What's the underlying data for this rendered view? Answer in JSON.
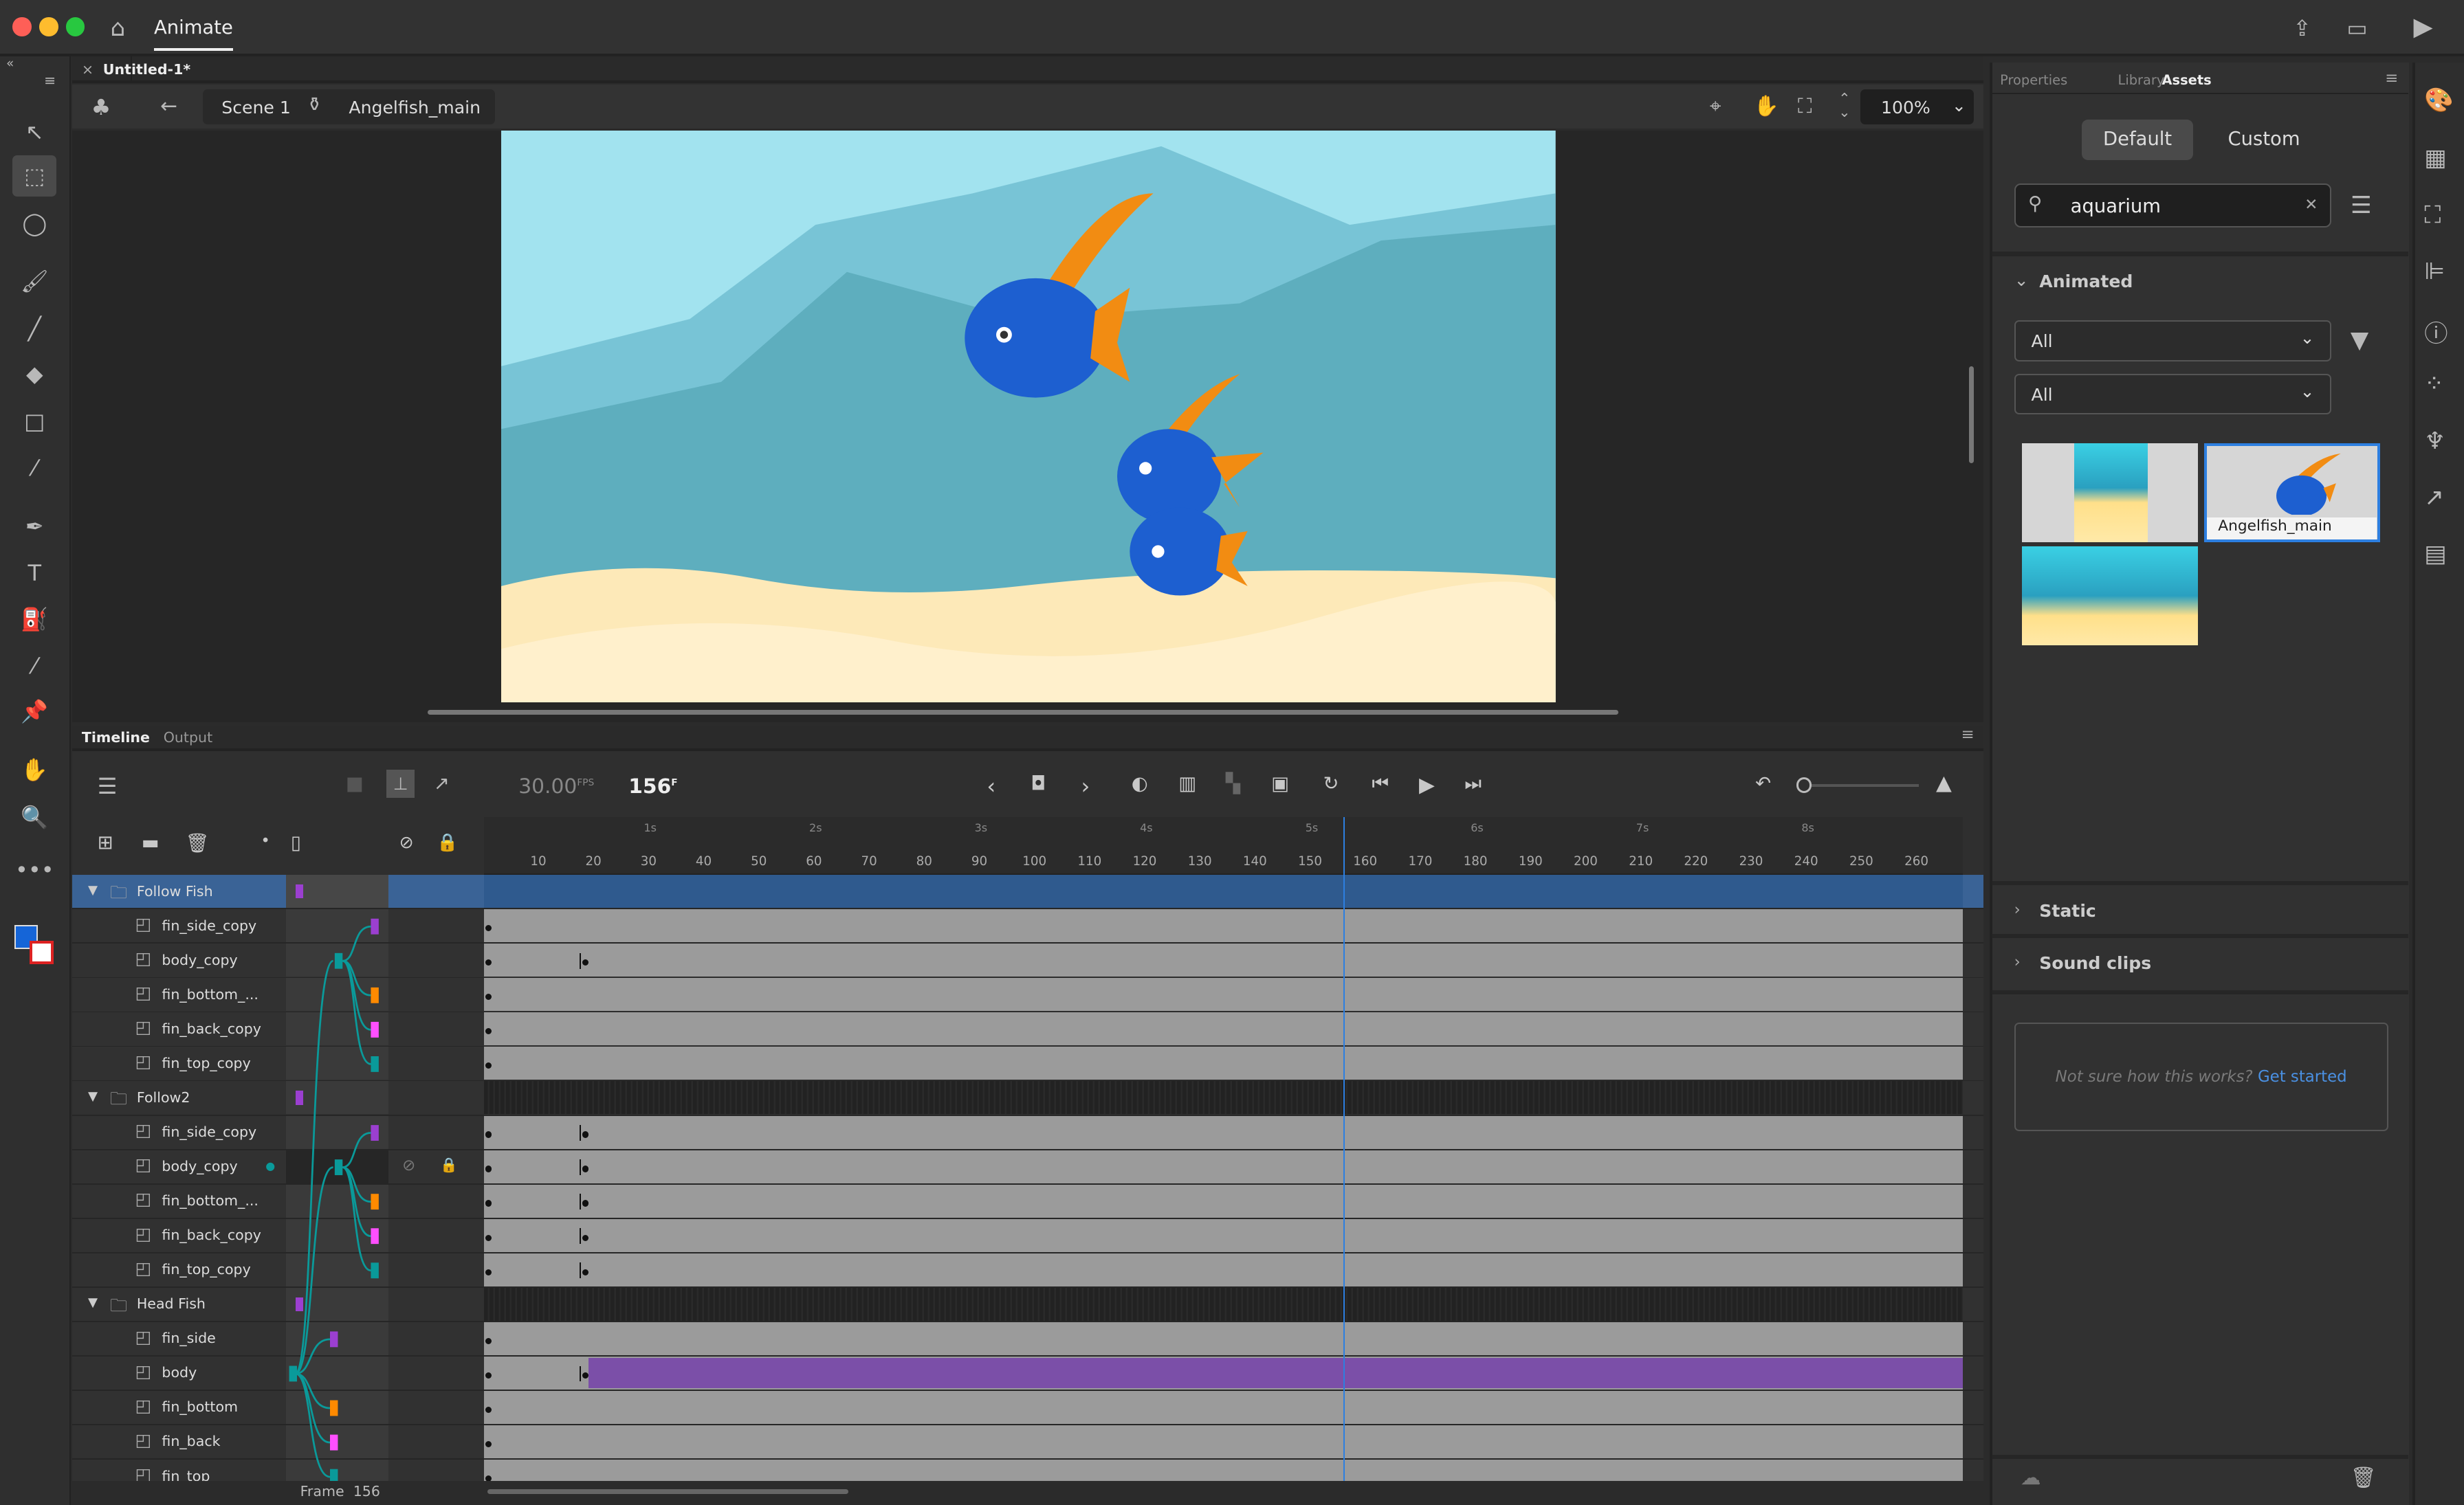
{
  "app": {
    "title": "Animate",
    "document_tab": "Untitled-1*"
  },
  "editbar": {
    "scene": "Scene 1",
    "symbol": "Angelfish_main",
    "zoom": "100%"
  },
  "timeline": {
    "tabs": [
      "Timeline",
      "Output"
    ],
    "fps": "30.00",
    "fps_unit": "FPS",
    "frame": "156",
    "frame_unit": "F",
    "current_frame": 156,
    "seconds_labels": [
      "1s",
      "2s",
      "3s",
      "4s",
      "5s",
      "6s",
      "7s",
      "8s"
    ],
    "frame_labels": [
      "10",
      "20",
      "30",
      "40",
      "50",
      "60",
      "70",
      "80",
      "90",
      "100",
      "110",
      "120",
      "130",
      "140",
      "150",
      "160",
      "170",
      "180",
      "190",
      "200",
      "210",
      "220",
      "230",
      "240",
      "250",
      "260"
    ],
    "status": "Frame  156",
    "layers": [
      {
        "name": "Follow Fish",
        "type": "folder",
        "marker": "#9b3fd0",
        "selected": true,
        "track": "selected"
      },
      {
        "name": "fin_side_copy",
        "type": "layer",
        "marker": "#9b3fd0",
        "track": "gray"
      },
      {
        "name": "body_copy",
        "type": "layer",
        "marker": "#0a9a9a",
        "track": "gray",
        "key": 18
      },
      {
        "name": "fin_bottom_...",
        "type": "layer",
        "marker": "#ff8a00",
        "track": "gray"
      },
      {
        "name": "fin_back_copy",
        "type": "layer",
        "marker": "#ff4fff",
        "track": "gray"
      },
      {
        "name": "fin_top_copy",
        "type": "layer",
        "marker": "#0a9a9a",
        "track": "gray"
      },
      {
        "name": "Follow2",
        "type": "folder",
        "marker": "#9b3fd0",
        "track": "dark"
      },
      {
        "name": "fin_side_copy",
        "type": "layer",
        "marker": "#9b3fd0",
        "track": "gray",
        "key": 18
      },
      {
        "name": "body_copy",
        "type": "layer",
        "marker": "#0a9a9a",
        "track": "gray",
        "key": 18,
        "hover": true
      },
      {
        "name": "fin_bottom_...",
        "type": "layer",
        "marker": "#ff8a00",
        "track": "gray",
        "key": 18
      },
      {
        "name": "fin_back_copy",
        "type": "layer",
        "marker": "#ff4fff",
        "track": "gray",
        "key": 18
      },
      {
        "name": "fin_top_copy",
        "type": "layer",
        "marker": "#0a9a9a",
        "track": "gray",
        "key": 18
      },
      {
        "name": "Head Fish",
        "type": "folder",
        "marker": "#9b3fd0",
        "track": "dark"
      },
      {
        "name": "fin_side",
        "type": "layer",
        "marker": "#9b3fd0",
        "track": "gray"
      },
      {
        "name": "body",
        "type": "layer",
        "marker": "#0a9a9a",
        "track": "tween",
        "key": 18
      },
      {
        "name": "fin_bottom",
        "type": "layer",
        "marker": "#ff8a00",
        "track": "gray"
      },
      {
        "name": "fin_back",
        "type": "layer",
        "marker": "#ff4fff",
        "track": "gray"
      },
      {
        "name": "fin_top",
        "type": "layer",
        "marker": "#0a9a9a",
        "track": "gray"
      }
    ]
  },
  "assets": {
    "tabs": [
      "Properties",
      "Library",
      "Assets"
    ],
    "active_tab": "Assets",
    "modes": [
      "Default",
      "Custom"
    ],
    "search_value": "aquarium",
    "section_animated": "Animated",
    "filter1": "All",
    "filter2": "All",
    "thumb_label": "Angelfish_main",
    "section_static": "Static",
    "section_sound": "Sound clips",
    "help_text": "Not sure how this works?",
    "help_link": "Get started"
  },
  "colors": {
    "accent": "#2d7fe0",
    "selected_row": "#3a6396",
    "tween": "#7b4fa8",
    "stage_water": "#8fd3e0",
    "sand": "#fde9b8"
  }
}
